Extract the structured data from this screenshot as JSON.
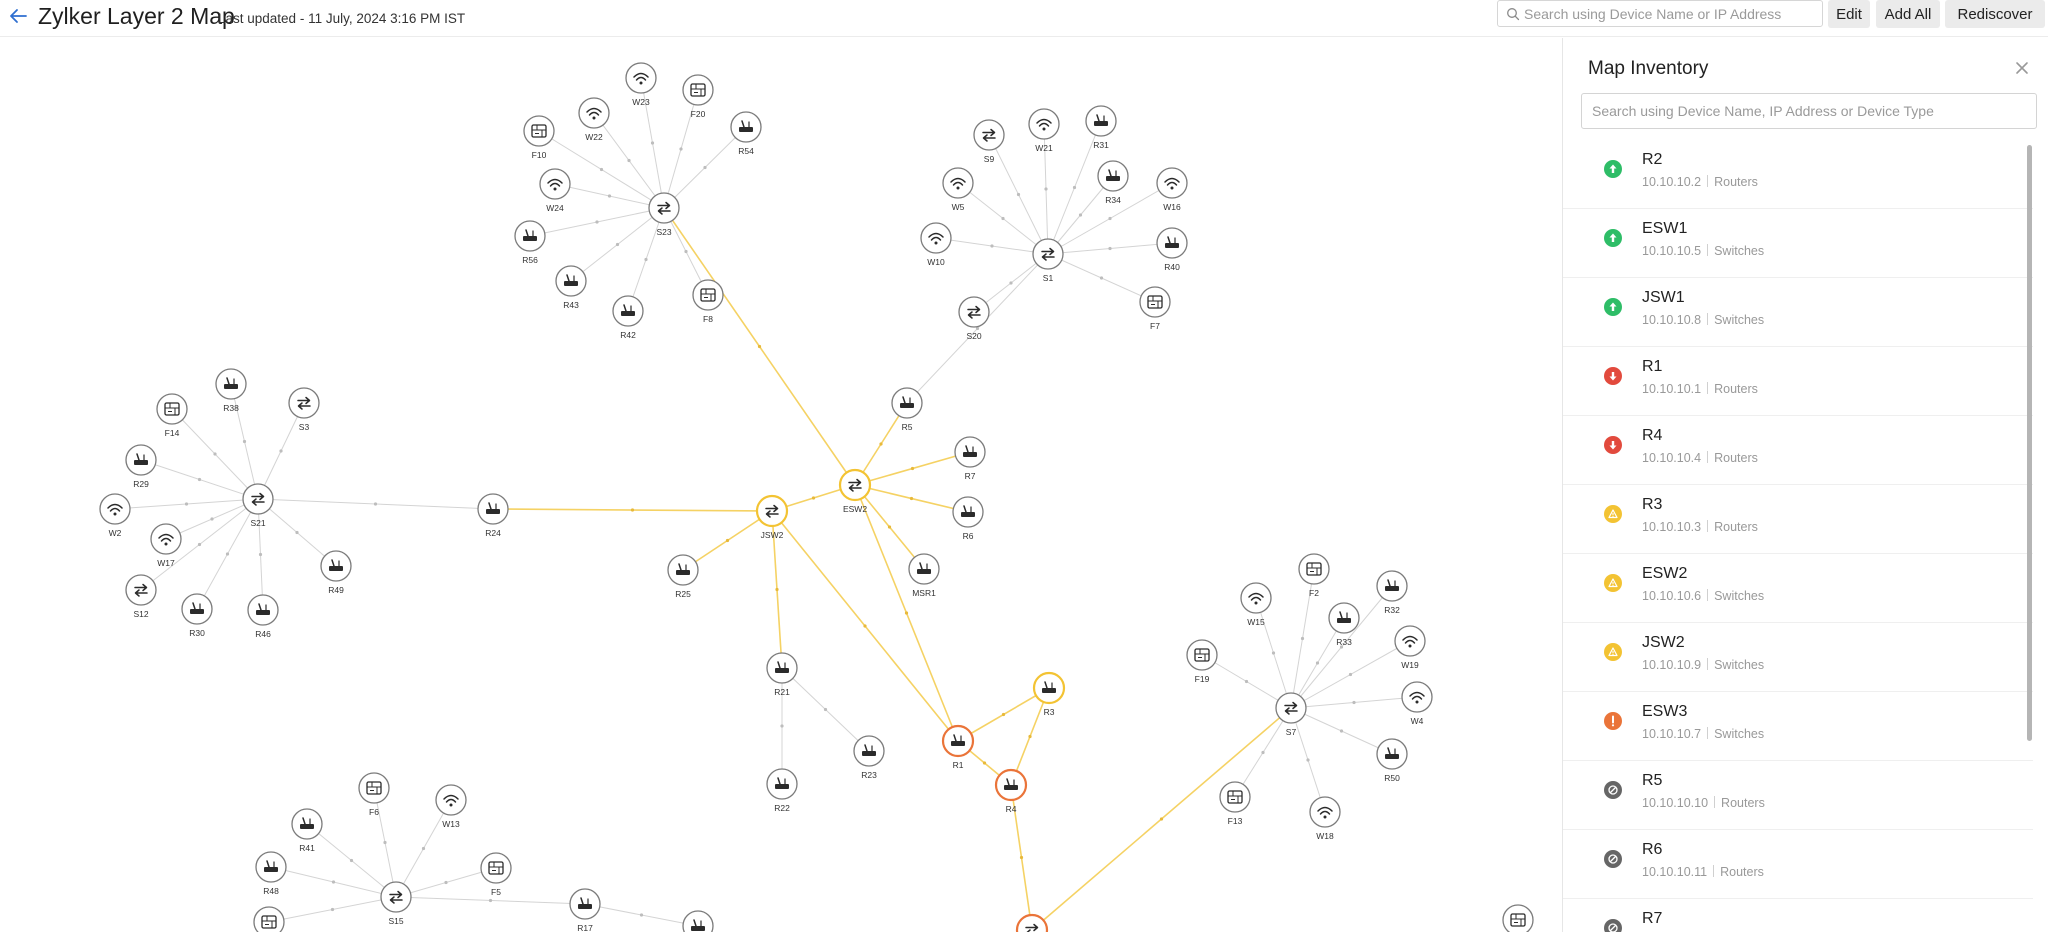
{
  "header": {
    "title": "Zylker Layer 2 Map",
    "last_updated": "Last updated - 11 July, 2024 3:16 PM IST",
    "search_placeholder": "Search using Device Name or IP Address",
    "edit_label": "Edit",
    "add_all_label": "Add All",
    "rediscover_label": "Rediscover"
  },
  "colors": {
    "accent": "#2f6fd0",
    "node_border": "#7b7b7b",
    "link": "#d4d4d4",
    "link_yellow": "#f5d264",
    "warning": "#f3c333",
    "critical": "#ea7439",
    "up": "#2ebd67",
    "down": "#e24a3d",
    "unmanaged": "#666666"
  },
  "map": {
    "nodes": [
      {
        "id": "W23",
        "type": "wifi",
        "status": "normal"
      },
      {
        "id": "F20",
        "type": "firewall",
        "status": "normal"
      },
      {
        "id": "W22",
        "type": "wifi",
        "status": "normal"
      },
      {
        "id": "R54",
        "type": "router",
        "status": "normal"
      },
      {
        "id": "F10",
        "type": "firewall",
        "status": "normal"
      },
      {
        "id": "W24",
        "type": "wifi",
        "status": "normal"
      },
      {
        "id": "S23",
        "type": "switch",
        "status": "normal"
      },
      {
        "id": "R56",
        "type": "router",
        "status": "normal"
      },
      {
        "id": "R43",
        "type": "router",
        "status": "normal"
      },
      {
        "id": "R42",
        "type": "router",
        "status": "normal"
      },
      {
        "id": "F8",
        "type": "firewall",
        "status": "normal"
      },
      {
        "id": "S9",
        "type": "switch",
        "status": "normal"
      },
      {
        "id": "W21",
        "type": "wifi",
        "status": "normal"
      },
      {
        "id": "R31",
        "type": "router",
        "status": "normal"
      },
      {
        "id": "W5",
        "type": "wifi",
        "status": "normal"
      },
      {
        "id": "R34",
        "type": "router",
        "status": "normal"
      },
      {
        "id": "W16",
        "type": "wifi",
        "status": "normal"
      },
      {
        "id": "W10",
        "type": "wifi",
        "status": "normal"
      },
      {
        "id": "S1",
        "type": "switch",
        "status": "normal"
      },
      {
        "id": "R40",
        "type": "router",
        "status": "normal"
      },
      {
        "id": "F7",
        "type": "firewall",
        "status": "normal"
      },
      {
        "id": "S20",
        "type": "switch",
        "status": "normal"
      },
      {
        "id": "R5",
        "type": "router",
        "status": "normal"
      },
      {
        "id": "R7",
        "type": "router",
        "status": "normal"
      },
      {
        "id": "ESW2",
        "type": "switch",
        "status": "warning"
      },
      {
        "id": "R6",
        "type": "router",
        "status": "normal"
      },
      {
        "id": "MSR1",
        "type": "router",
        "status": "normal"
      },
      {
        "id": "JSW2",
        "type": "switch",
        "status": "warning"
      },
      {
        "id": "R25",
        "type": "router",
        "status": "normal"
      },
      {
        "id": "R24",
        "type": "router",
        "status": "normal"
      },
      {
        "id": "F14",
        "type": "firewall",
        "status": "normal"
      },
      {
        "id": "R38",
        "type": "router",
        "status": "normal"
      },
      {
        "id": "S3",
        "type": "switch",
        "status": "normal"
      },
      {
        "id": "R29",
        "type": "router",
        "status": "normal"
      },
      {
        "id": "W2",
        "type": "wifi",
        "status": "normal"
      },
      {
        "id": "S21",
        "type": "switch",
        "status": "normal"
      },
      {
        "id": "W17",
        "type": "wifi",
        "status": "normal"
      },
      {
        "id": "R49",
        "type": "router",
        "status": "normal"
      },
      {
        "id": "S12",
        "type": "switch",
        "status": "normal"
      },
      {
        "id": "R30",
        "type": "router",
        "status": "normal"
      },
      {
        "id": "R46",
        "type": "router",
        "status": "normal"
      },
      {
        "id": "R21",
        "type": "router",
        "status": "normal"
      },
      {
        "id": "R23",
        "type": "router",
        "status": "normal"
      },
      {
        "id": "R22",
        "type": "router",
        "status": "normal"
      },
      {
        "id": "R1",
        "type": "router",
        "status": "critical"
      },
      {
        "id": "R3",
        "type": "router",
        "status": "warning"
      },
      {
        "id": "R4",
        "type": "router",
        "status": "critical"
      },
      {
        "id": "F2",
        "type": "firewall",
        "status": "normal"
      },
      {
        "id": "W15",
        "type": "wifi",
        "status": "normal"
      },
      {
        "id": "R32",
        "type": "router",
        "status": "normal"
      },
      {
        "id": "R33",
        "type": "router",
        "status": "normal"
      },
      {
        "id": "W19",
        "type": "wifi",
        "status": "normal"
      },
      {
        "id": "F19",
        "type": "firewall",
        "status": "normal"
      },
      {
        "id": "S7",
        "type": "switch",
        "status": "normal"
      },
      {
        "id": "W4",
        "type": "wifi",
        "status": "normal"
      },
      {
        "id": "R50",
        "type": "router",
        "status": "normal"
      },
      {
        "id": "F13",
        "type": "firewall",
        "status": "normal"
      },
      {
        "id": "W18",
        "type": "wifi",
        "status": "normal"
      },
      {
        "id": "F6",
        "type": "firewall",
        "status": "normal"
      },
      {
        "id": "W13",
        "type": "wifi",
        "status": "normal"
      },
      {
        "id": "R41",
        "type": "router",
        "status": "normal"
      },
      {
        "id": "R48",
        "type": "router",
        "status": "normal"
      },
      {
        "id": "F5",
        "type": "firewall",
        "status": "normal"
      },
      {
        "id": "S15",
        "type": "switch",
        "status": "normal"
      },
      {
        "id": "R17",
        "type": "router",
        "status": "normal"
      },
      {
        "id": "F_BL",
        "type": "firewall",
        "status": "normal",
        "label": ""
      },
      {
        "id": "N_B1",
        "type": "router",
        "status": "normal",
        "label": ""
      },
      {
        "id": "N_B2",
        "type": "switch",
        "status": "critical",
        "label": ""
      },
      {
        "id": "F_BR",
        "type": "firewall",
        "status": "normal",
        "label": ""
      }
    ],
    "links": [
      [
        "S23",
        "W23"
      ],
      [
        "S23",
        "F20"
      ],
      [
        "S23",
        "W22"
      ],
      [
        "S23",
        "R54"
      ],
      [
        "S23",
        "F10"
      ],
      [
        "S23",
        "W24"
      ],
      [
        "S23",
        "R56"
      ],
      [
        "S23",
        "R43"
      ],
      [
        "S23",
        "R42"
      ],
      [
        "S23",
        "F8"
      ],
      [
        "S23",
        "ESW2"
      ],
      [
        "S1",
        "S9"
      ],
      [
        "S1",
        "W21"
      ],
      [
        "S1",
        "R31"
      ],
      [
        "S1",
        "W5"
      ],
      [
        "S1",
        "R34"
      ],
      [
        "S1",
        "W16"
      ],
      [
        "S1",
        "W10"
      ],
      [
        "S1",
        "R40"
      ],
      [
        "S1",
        "F7"
      ],
      [
        "S1",
        "S20"
      ],
      [
        "S1",
        "R5"
      ],
      [
        "R5",
        "ESW2"
      ],
      [
        "ESW2",
        "R7"
      ],
      [
        "ESW2",
        "R6"
      ],
      [
        "ESW2",
        "MSR1"
      ],
      [
        "ESW2",
        "JSW2"
      ],
      [
        "ESW2",
        "R1"
      ],
      [
        "JSW2",
        "R25"
      ],
      [
        "JSW2",
        "R24"
      ],
      [
        "JSW2",
        "R1"
      ],
      [
        "JSW2",
        "R21"
      ],
      [
        "R24",
        "S21"
      ],
      [
        "S21",
        "F14"
      ],
      [
        "S21",
        "R38"
      ],
      [
        "S21",
        "S3"
      ],
      [
        "S21",
        "R29"
      ],
      [
        "S21",
        "W2"
      ],
      [
        "S21",
        "W17"
      ],
      [
        "S21",
        "R49"
      ],
      [
        "S21",
        "S12"
      ],
      [
        "S21",
        "R30"
      ],
      [
        "S21",
        "R46"
      ],
      [
        "R21",
        "R23"
      ],
      [
        "R21",
        "R22"
      ],
      [
        "R1",
        "R3"
      ],
      [
        "R1",
        "R4"
      ],
      [
        "R3",
        "R4"
      ],
      [
        "R4",
        "N_B2"
      ],
      [
        "S7",
        "F2"
      ],
      [
        "S7",
        "W15"
      ],
      [
        "S7",
        "R32"
      ],
      [
        "S7",
        "R33"
      ],
      [
        "S7",
        "W19"
      ],
      [
        "S7",
        "F19"
      ],
      [
        "S7",
        "W4"
      ],
      [
        "S7",
        "R50"
      ],
      [
        "S7",
        "F13"
      ],
      [
        "S7",
        "W18"
      ],
      [
        "S7",
        "N_B2"
      ],
      [
        "S15",
        "F6"
      ],
      [
        "S15",
        "W13"
      ],
      [
        "S15",
        "R41"
      ],
      [
        "S15",
        "R48"
      ],
      [
        "S15",
        "F5"
      ],
      [
        "S15",
        "R17"
      ],
      [
        "S15",
        "F_BL"
      ],
      [
        "R17",
        "N_B1"
      ]
    ]
  },
  "inventory": {
    "title": "Map Inventory",
    "search_placeholder": "Search using Device Name, IP Address or Device Type",
    "items": [
      {
        "name": "R2",
        "ip": "10.10.10.2",
        "type": "Routers",
        "status": "up"
      },
      {
        "name": "ESW1",
        "ip": "10.10.10.5",
        "type": "Switches",
        "status": "up"
      },
      {
        "name": "JSW1",
        "ip": "10.10.10.8",
        "type": "Switches",
        "status": "up"
      },
      {
        "name": "R1",
        "ip": "10.10.10.1",
        "type": "Routers",
        "status": "down"
      },
      {
        "name": "R4",
        "ip": "10.10.10.4",
        "type": "Routers",
        "status": "down"
      },
      {
        "name": "R3",
        "ip": "10.10.10.3",
        "type": "Routers",
        "status": "warning"
      },
      {
        "name": "ESW2",
        "ip": "10.10.10.6",
        "type": "Switches",
        "status": "warning"
      },
      {
        "name": "JSW2",
        "ip": "10.10.10.9",
        "type": "Switches",
        "status": "warning"
      },
      {
        "name": "ESW3",
        "ip": "10.10.10.7",
        "type": "Switches",
        "status": "critical"
      },
      {
        "name": "R5",
        "ip": "10.10.10.10",
        "type": "Routers",
        "status": "unmanaged"
      },
      {
        "name": "R6",
        "ip": "10.10.10.11",
        "type": "Routers",
        "status": "unmanaged"
      },
      {
        "name": "R7",
        "ip": "",
        "type": "",
        "status": "unmanaged"
      }
    ]
  }
}
